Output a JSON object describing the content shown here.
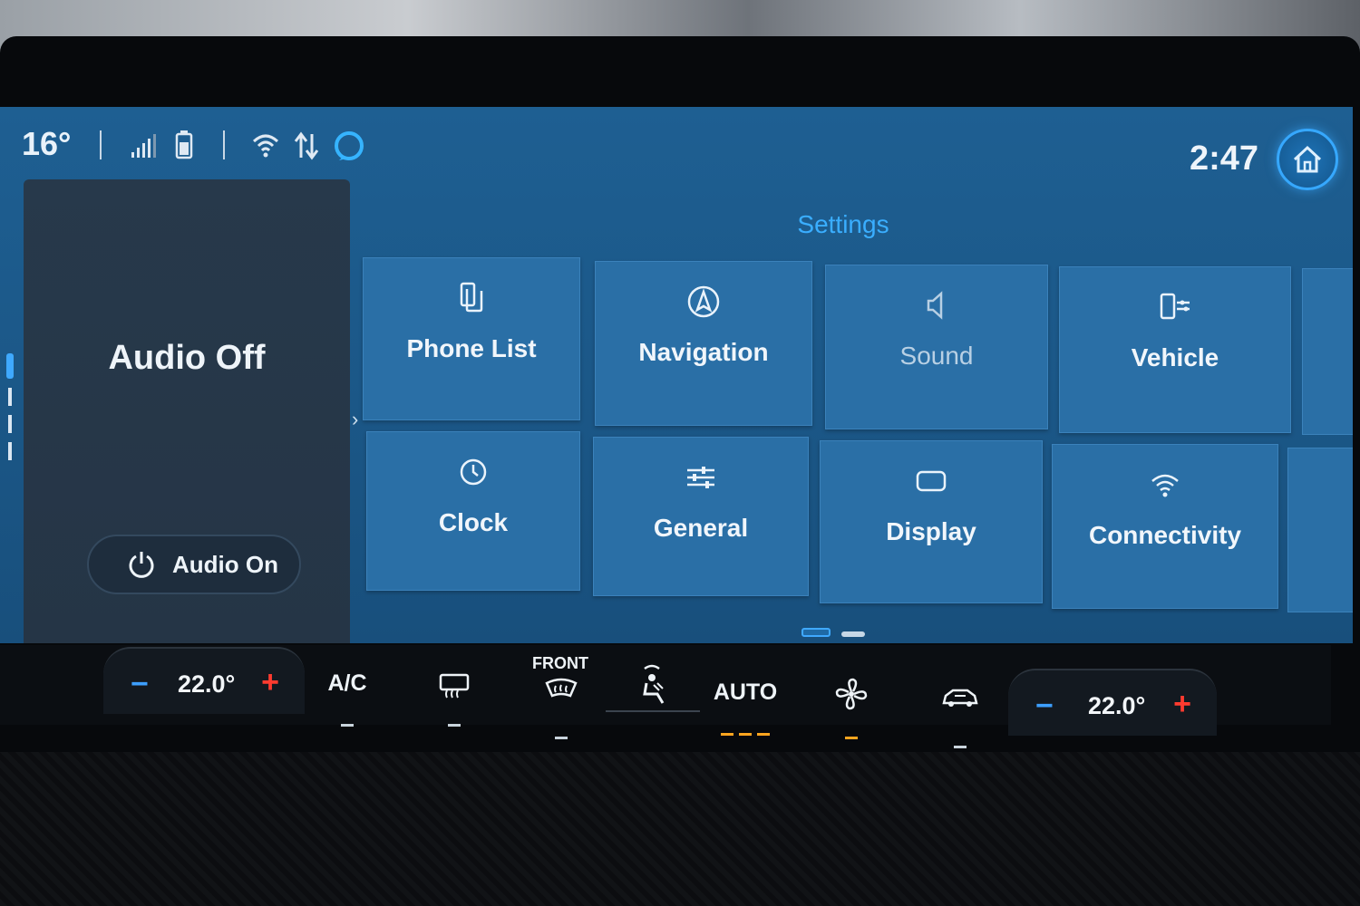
{
  "status_bar": {
    "outside_temp": "16°",
    "time": "2:47",
    "icons": [
      "signal-icon",
      "phone-battery-icon",
      "wifi-icon",
      "data-transfer-icon",
      "alexa-icon"
    ],
    "accent_color": "#3aa8ff"
  },
  "audio_panel": {
    "title": "Audio Off",
    "button_label": "Audio On"
  },
  "settings": {
    "title": "Settings",
    "tiles": [
      {
        "label": "Phone List",
        "icon": "phone-list-icon"
      },
      {
        "label": "Navigation",
        "icon": "navigation-icon"
      },
      {
        "label": "Sound",
        "icon": "speaker-icon"
      },
      {
        "label": "Vehicle",
        "icon": "vehicle-icon"
      },
      {
        "label": "Clock",
        "icon": "clock-icon"
      },
      {
        "label": "General",
        "icon": "sliders-icon"
      },
      {
        "label": "Display",
        "icon": "display-icon"
      },
      {
        "label": "Connectivity",
        "icon": "wifi-icon"
      }
    ],
    "pager": {
      "pages": 2,
      "current": 1
    }
  },
  "climate": {
    "driver_temp": "22.0°",
    "passenger_temp": "22.0°",
    "ac_label": "A/C",
    "front_label": "FRONT",
    "auto_label": "AUTO",
    "minus_color": "#3d9fff",
    "plus_color": "#ff3b2f",
    "indicator_on_color": "#ffa51f"
  }
}
